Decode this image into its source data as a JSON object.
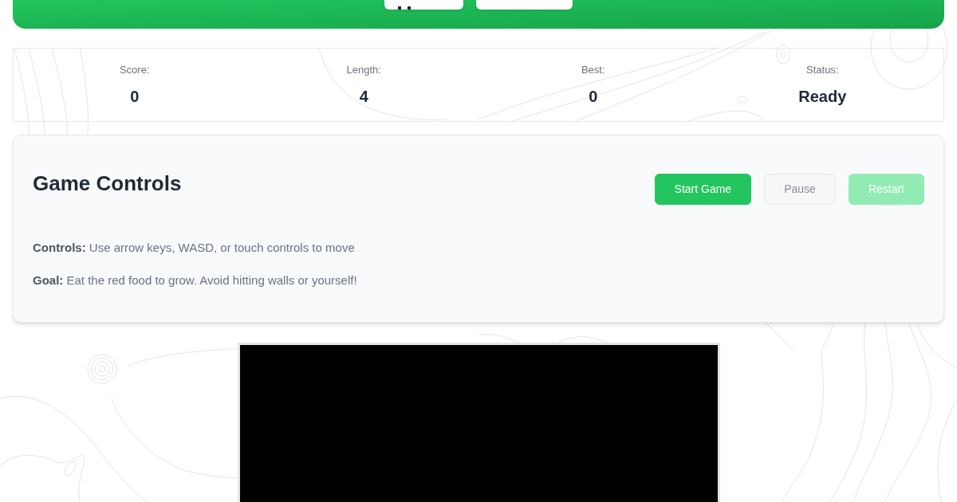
{
  "stats": [
    {
      "label": "Score:",
      "value": "0"
    },
    {
      "label": "Length:",
      "value": "4"
    },
    {
      "label": "Best:",
      "value": "0"
    },
    {
      "label": "Status:",
      "value": "Ready"
    }
  ],
  "controls_panel": {
    "title": "Game Controls",
    "buttons": [
      {
        "label": "Start Game",
        "kind": "primary",
        "disabled": false
      },
      {
        "label": "Pause",
        "kind": "secondary",
        "disabled": true
      },
      {
        "label": "Restart",
        "kind": "primary",
        "disabled": true
      }
    ],
    "instructions": [
      "**Controls:** Use arrow keys, WASD, or touch controls to move",
      "**Goal:** Eat the red food to grow. Avoid hitting walls or yourself!"
    ]
  }
}
